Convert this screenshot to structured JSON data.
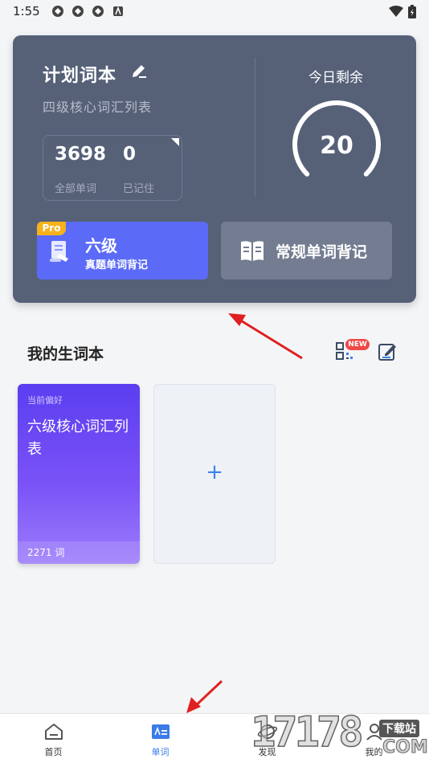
{
  "status_bar": {
    "time": "1:55"
  },
  "plan": {
    "title": "计划词本",
    "subtitle": "四级核心词汇列表",
    "total_words": "3698",
    "total_words_label": "全部单词",
    "memorized": "0",
    "memorized_label": "已记住",
    "today_label": "今日剩余",
    "today_remaining": "20",
    "gauge_fraction": 0.0
  },
  "buttons": {
    "six_badge": "Pro",
    "six_title": "六级",
    "six_sub": "真题单词背记",
    "regular": "常规单词背记"
  },
  "section": {
    "title": "我的生词本",
    "new_badge": "NEW"
  },
  "vocab_card": {
    "tag": "当前偏好",
    "title": "六级核心词汇列表",
    "count": "2271 词"
  },
  "add_card": {
    "plus": "+"
  },
  "tabs": [
    {
      "label": "首页"
    },
    {
      "label": "单词"
    },
    {
      "label": "发现"
    },
    {
      "label": "我的"
    }
  ],
  "watermark": {
    "digits": "17178",
    "top": "下载站",
    "com": "COM"
  },
  "colors": {
    "card_bg": "#566178",
    "accent": "#5b6bf8",
    "tab_active": "#3a7be8",
    "arrow": "#e02020"
  }
}
